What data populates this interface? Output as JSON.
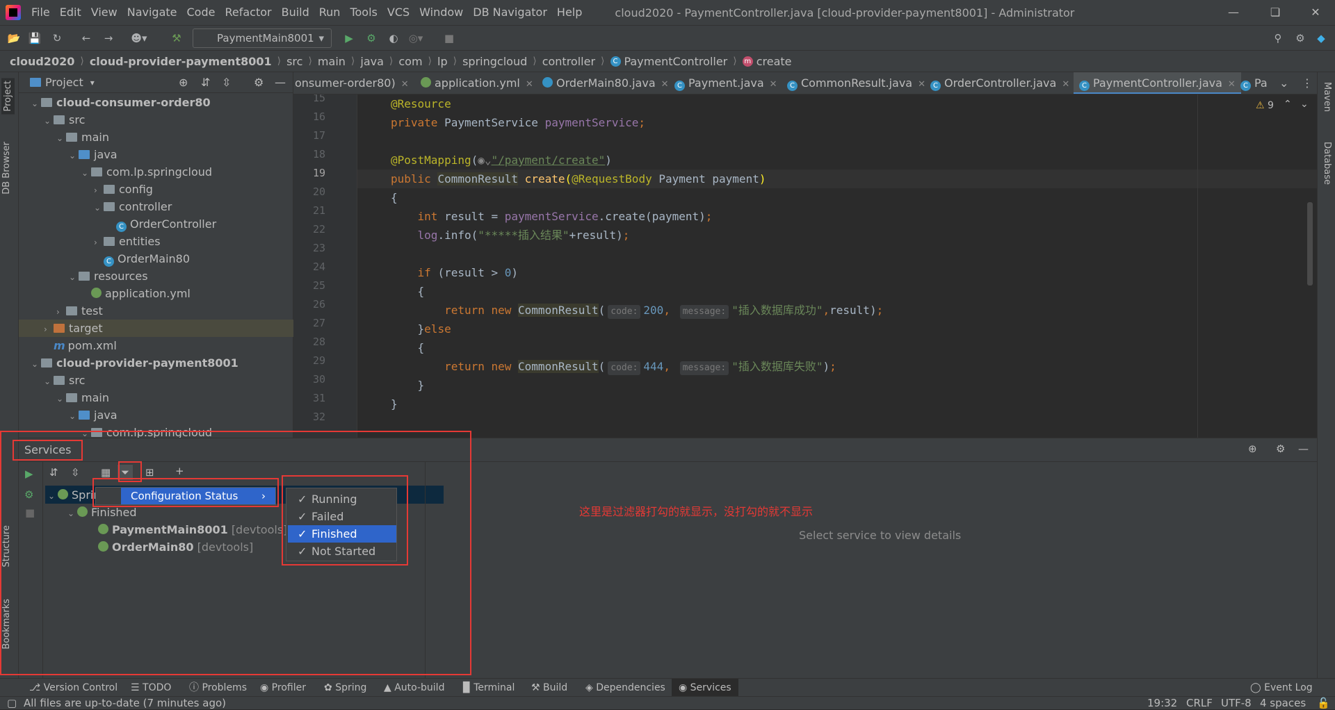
{
  "window": {
    "title": "cloud2020 - PaymentController.java [cloud-provider-payment8001] - Administrator",
    "menu": [
      "File",
      "Edit",
      "View",
      "Navigate",
      "Code",
      "Refactor",
      "Build",
      "Run",
      "Tools",
      "VCS",
      "Window",
      "DB Navigator",
      "Help"
    ]
  },
  "toolbar": {
    "run_config": "PaymentMain8001"
  },
  "breadcrumb": [
    "cloud2020",
    "cloud-provider-payment8001",
    "src",
    "main",
    "java",
    "com",
    "lp",
    "springcloud",
    "controller",
    "PaymentController",
    "create"
  ],
  "project_panel": {
    "title": "Project",
    "tree": [
      {
        "label": "cloud-consumer-order80",
        "type": "module",
        "arrow": "v"
      },
      {
        "label": "src",
        "type": "folder",
        "arrow": "v"
      },
      {
        "label": "main",
        "type": "folder",
        "arrow": "v"
      },
      {
        "label": "java",
        "type": "folder-blue",
        "arrow": "v"
      },
      {
        "label": "com.lp.springcloud",
        "type": "folder",
        "arrow": "v"
      },
      {
        "label": "config",
        "type": "folder",
        "arrow": ">"
      },
      {
        "label": "controller",
        "type": "folder",
        "arrow": "v"
      },
      {
        "label": "OrderController",
        "type": "class",
        "arrow": ""
      },
      {
        "label": "entities",
        "type": "folder",
        "arrow": ">"
      },
      {
        "label": "OrderMain80",
        "type": "spring-class",
        "arrow": ""
      },
      {
        "label": "resources",
        "type": "folder",
        "arrow": "v"
      },
      {
        "label": "application.yml",
        "type": "yml",
        "arrow": ""
      },
      {
        "label": "test",
        "type": "folder",
        "arrow": ">"
      },
      {
        "label": "target",
        "type": "folder-orange",
        "arrow": ">"
      },
      {
        "label": "pom.xml",
        "type": "maven",
        "arrow": ""
      },
      {
        "label": "cloud-provider-payment8001",
        "type": "module",
        "arrow": "v"
      },
      {
        "label": "src",
        "type": "folder",
        "arrow": "v"
      },
      {
        "label": "main",
        "type": "folder",
        "arrow": "v"
      },
      {
        "label": "java",
        "type": "folder-blue",
        "arrow": "v"
      },
      {
        "label": "com.lp.springcloud",
        "type": "folder",
        "arrow": "v"
      }
    ]
  },
  "editor_tabs": [
    "onsumer-order80)",
    "application.yml",
    "OrderMain80.java",
    "Payment.java",
    "CommonResult.java",
    "OrderController.java",
    "PaymentController.java",
    "Pa"
  ],
  "editor": {
    "warnings": "9",
    "lines": [
      15,
      16,
      17,
      18,
      19,
      20,
      21,
      22,
      23,
      24,
      25,
      26,
      27,
      28,
      29,
      30,
      31,
      32
    ],
    "current_line": 19
  },
  "services": {
    "title": "Services",
    "tree_root": "Spring",
    "group": "Finished",
    "items": [
      {
        "name": "PaymentMain8001",
        "tag": "[devtools]"
      },
      {
        "name": "OrderMain80",
        "tag": "[devtools]"
      }
    ],
    "popup_menu_item": "Configuration Status",
    "filter_options": [
      {
        "label": "Running",
        "checked": true
      },
      {
        "label": "Failed",
        "checked": true
      },
      {
        "label": "Finished",
        "checked": true
      },
      {
        "label": "Not Started",
        "checked": true
      }
    ],
    "annotation": "这里是过滤器打勾的就显示，没打勾的就不显示",
    "empty_detail": "Select service to view details"
  },
  "side_tabs": {
    "left": [
      "Project",
      "DB Browser",
      "Structure",
      "Bookmarks"
    ],
    "right": [
      "Maven",
      "Database"
    ]
  },
  "bottom_tabs": [
    "Version Control",
    "TODO",
    "Problems",
    "Profiler",
    "Spring",
    "Auto-build",
    "Terminal",
    "Build",
    "Dependencies",
    "Services",
    "Event Log"
  ],
  "status": {
    "message": "All files are up-to-date (7 minutes ago)",
    "position": "19:32",
    "line_sep": "CRLF",
    "encoding": "UTF-8",
    "indent": "4 spaces"
  },
  "colors": {
    "accent": "#2f65ca",
    "annotation_red": "#e53935",
    "keyword": "#cc7832",
    "string": "#6a8759"
  }
}
